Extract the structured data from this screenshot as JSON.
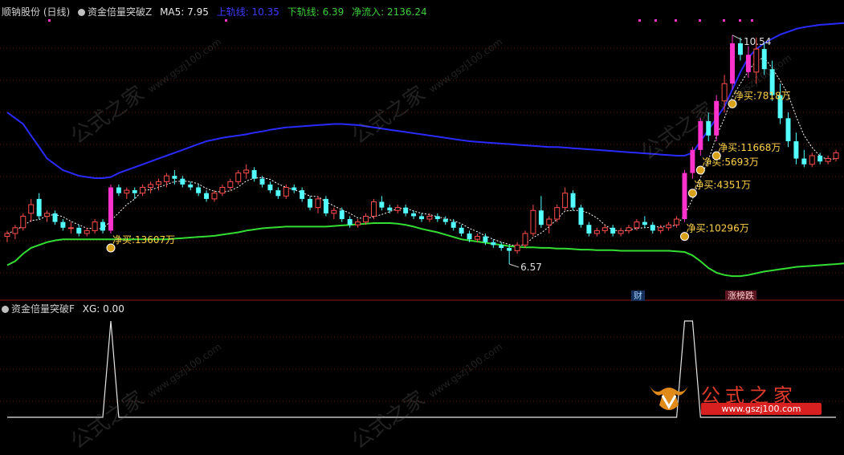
{
  "header": {
    "stock_name": "顺钠股份 (日线)",
    "indicator_name": "资金倍量突破Z",
    "ma5": "MA5: 7.95",
    "upper": "上轨线: 10.35",
    "lower": "下轨线: 6.39",
    "inflow": "净流入: 2136.24"
  },
  "sub_header": {
    "indicator_name": "资金倍量突破F",
    "xg": "XG: 0.00"
  },
  "tags": {
    "finance": "财",
    "limit": "涨榜跌"
  },
  "watermark": {
    "text": "公式之家",
    "url": "www.gszj100.com"
  },
  "logo": {
    "title": "公式之家",
    "url": "www.gszj100.com"
  },
  "colors": {
    "up": "#ff4d4d",
    "down": "#54ffff",
    "signal": "#ff33cc",
    "upper_band": "#2a2aff",
    "lower_band": "#33dd33",
    "ma": "#ffffff",
    "annotation": "#ffd24a"
  },
  "chart_data": {
    "type": "candlestick",
    "price_range": [
      6.0,
      10.9
    ],
    "high_label": "10.54",
    "low_label": "6.57",
    "candles": [
      [
        7.05,
        7.15,
        6.95,
        7.1
      ],
      [
        7.1,
        7.25,
        7.0,
        7.2
      ],
      [
        7.2,
        7.45,
        7.15,
        7.4
      ],
      [
        7.45,
        7.7,
        7.3,
        7.6
      ],
      [
        7.7,
        7.8,
        7.35,
        7.4
      ],
      [
        7.4,
        7.5,
        7.3,
        7.45
      ],
      [
        7.45,
        7.5,
        7.25,
        7.3
      ],
      [
        7.3,
        7.35,
        7.15,
        7.2
      ],
      [
        7.2,
        7.3,
        7.1,
        7.2
      ],
      [
        7.2,
        7.25,
        7.05,
        7.1
      ],
      [
        7.1,
        7.2,
        7.05,
        7.15
      ],
      [
        7.15,
        7.35,
        7.1,
        7.3
      ],
      [
        7.3,
        7.35,
        7.1,
        7.15
      ],
      [
        7.15,
        7.95,
        7.1,
        7.9
      ],
      [
        7.9,
        7.95,
        7.75,
        7.8
      ],
      [
        7.8,
        7.9,
        7.7,
        7.85
      ],
      [
        7.85,
        7.9,
        7.7,
        7.8
      ],
      [
        7.8,
        7.95,
        7.75,
        7.9
      ],
      [
        7.9,
        8.0,
        7.8,
        7.95
      ],
      [
        7.95,
        8.05,
        7.85,
        8.0
      ],
      [
        8.0,
        8.15,
        7.9,
        8.1
      ],
      [
        8.1,
        8.2,
        7.95,
        8.05
      ],
      [
        8.05,
        8.1,
        7.9,
        7.95
      ],
      [
        7.95,
        8.0,
        7.85,
        7.9
      ],
      [
        7.9,
        7.95,
        7.75,
        7.8
      ],
      [
        7.8,
        7.85,
        7.65,
        7.7
      ],
      [
        7.7,
        7.85,
        7.65,
        7.8
      ],
      [
        7.8,
        7.95,
        7.75,
        7.9
      ],
      [
        7.9,
        8.05,
        7.85,
        8.0
      ],
      [
        8.0,
        8.2,
        7.95,
        8.15
      ],
      [
        8.15,
        8.3,
        8.05,
        8.2
      ],
      [
        8.2,
        8.25,
        8.0,
        8.05
      ],
      [
        8.05,
        8.1,
        7.9,
        7.95
      ],
      [
        7.95,
        8.0,
        7.8,
        7.85
      ],
      [
        7.85,
        7.9,
        7.7,
        7.75
      ],
      [
        7.75,
        7.95,
        7.7,
        7.9
      ],
      [
        7.9,
        7.95,
        7.8,
        7.85
      ],
      [
        7.85,
        7.9,
        7.65,
        7.7
      ],
      [
        7.7,
        7.75,
        7.5,
        7.55
      ],
      [
        7.55,
        7.75,
        7.45,
        7.7
      ],
      [
        7.7,
        7.75,
        7.4,
        7.45
      ],
      [
        7.45,
        7.55,
        7.35,
        7.5
      ],
      [
        7.5,
        7.55,
        7.3,
        7.35
      ],
      [
        7.35,
        7.4,
        7.2,
        7.25
      ],
      [
        7.25,
        7.35,
        7.2,
        7.3
      ],
      [
        7.3,
        7.45,
        7.25,
        7.4
      ],
      [
        7.4,
        7.7,
        7.35,
        7.65
      ],
      [
        7.65,
        7.75,
        7.5,
        7.55
      ],
      [
        7.55,
        7.6,
        7.45,
        7.5
      ],
      [
        7.5,
        7.6,
        7.45,
        7.55
      ],
      [
        7.55,
        7.6,
        7.4,
        7.45
      ],
      [
        7.45,
        7.5,
        7.35,
        7.4
      ],
      [
        7.4,
        7.45,
        7.3,
        7.35
      ],
      [
        7.35,
        7.45,
        7.3,
        7.4
      ],
      [
        7.4,
        7.45,
        7.3,
        7.35
      ],
      [
        7.35,
        7.4,
        7.25,
        7.3
      ],
      [
        7.3,
        7.35,
        7.15,
        7.2
      ],
      [
        7.2,
        7.25,
        7.05,
        7.1
      ],
      [
        7.1,
        7.15,
        6.95,
        7.0
      ],
      [
        7.0,
        7.1,
        6.95,
        7.05
      ],
      [
        7.05,
        7.1,
        6.9,
        6.95
      ],
      [
        6.95,
        7.0,
        6.85,
        6.9
      ],
      [
        6.9,
        6.95,
        6.8,
        6.85
      ],
      [
        6.85,
        6.9,
        6.57,
        6.8
      ],
      [
        6.8,
        6.95,
        6.75,
        6.9
      ],
      [
        6.9,
        7.15,
        6.85,
        7.1
      ],
      [
        7.1,
        7.6,
        7.05,
        7.5
      ],
      [
        7.5,
        7.75,
        7.2,
        7.25
      ],
      [
        7.25,
        7.4,
        7.1,
        7.35
      ],
      [
        7.35,
        7.6,
        7.3,
        7.55
      ],
      [
        7.55,
        7.9,
        7.5,
        7.8
      ],
      [
        7.8,
        7.85,
        7.5,
        7.55
      ],
      [
        7.55,
        7.6,
        7.2,
        7.25
      ],
      [
        7.25,
        7.3,
        7.05,
        7.1
      ],
      [
        7.1,
        7.2,
        7.05,
        7.15
      ],
      [
        7.15,
        7.25,
        7.1,
        7.2
      ],
      [
        7.2,
        7.25,
        7.05,
        7.1
      ],
      [
        7.1,
        7.2,
        7.05,
        7.15
      ],
      [
        7.15,
        7.25,
        7.1,
        7.2
      ],
      [
        7.2,
        7.35,
        7.15,
        7.3
      ],
      [
        7.3,
        7.4,
        7.2,
        7.25
      ],
      [
        7.25,
        7.3,
        7.1,
        7.15
      ],
      [
        7.15,
        7.25,
        7.1,
        7.2
      ],
      [
        7.2,
        7.3,
        7.15,
        7.25
      ],
      [
        7.25,
        7.4,
        7.2,
        7.35
      ],
      [
        7.35,
        8.2,
        7.3,
        8.15
      ],
      [
        8.15,
        8.6,
        8.05,
        8.55
      ],
      [
        8.55,
        9.1,
        8.45,
        9.05
      ],
      [
        9.05,
        9.2,
        8.7,
        8.8
      ],
      [
        8.8,
        9.5,
        8.7,
        9.4
      ],
      [
        9.4,
        9.85,
        9.2,
        9.7
      ],
      [
        9.7,
        10.54,
        9.6,
        10.4
      ],
      [
        10.4,
        10.5,
        10.1,
        10.2
      ],
      [
        10.2,
        10.35,
        9.8,
        9.9
      ],
      [
        9.9,
        10.5,
        9.7,
        10.3
      ],
      [
        10.3,
        10.4,
        9.85,
        9.95
      ],
      [
        9.95,
        10.1,
        9.4,
        9.5
      ],
      [
        9.5,
        9.7,
        9.0,
        9.1
      ],
      [
        9.1,
        9.2,
        8.6,
        8.7
      ],
      [
        8.7,
        8.85,
        8.3,
        8.4
      ],
      [
        8.4,
        8.55,
        8.25,
        8.3
      ],
      [
        8.3,
        8.5,
        8.25,
        8.45
      ],
      [
        8.45,
        8.5,
        8.3,
        8.35
      ],
      [
        8.35,
        8.45,
        8.3,
        8.4
      ],
      [
        8.4,
        8.55,
        8.35,
        8.5
      ]
    ],
    "signal_indices": [
      13,
      85,
      86,
      87,
      89,
      91,
      93
    ],
    "upper_band": [
      9.2,
      9.1,
      9.0,
      8.8,
      8.6,
      8.4,
      8.3,
      8.2,
      8.15,
      8.1,
      8.08,
      8.06,
      8.06,
      8.08,
      8.15,
      8.2,
      8.25,
      8.3,
      8.35,
      8.4,
      8.45,
      8.5,
      8.55,
      8.6,
      8.65,
      8.7,
      8.73,
      8.76,
      8.78,
      8.8,
      8.82,
      8.85,
      8.87,
      8.9,
      8.92,
      8.94,
      8.95,
      8.96,
      8.97,
      8.98,
      8.99,
      9.0,
      9.0,
      8.99,
      8.98,
      8.96,
      8.94,
      8.92,
      8.9,
      8.88,
      8.86,
      8.84,
      8.82,
      8.8,
      8.78,
      8.76,
      8.74,
      8.72,
      8.7,
      8.69,
      8.68,
      8.67,
      8.66,
      8.65,
      8.64,
      8.63,
      8.62,
      8.61,
      8.6,
      8.6,
      8.59,
      8.58,
      8.57,
      8.56,
      8.55,
      8.54,
      8.53,
      8.52,
      8.51,
      8.5,
      8.49,
      8.48,
      8.47,
      8.46,
      8.45,
      8.45,
      8.5,
      8.7,
      8.9,
      9.1,
      9.3,
      9.6,
      9.9,
      10.15,
      10.3,
      10.4,
      10.48,
      10.55,
      10.6,
      10.65,
      10.68,
      10.7,
      10.72,
      10.73,
      10.74,
      10.75
    ],
    "lower_band": [
      6.55,
      6.62,
      6.75,
      6.85,
      6.9,
      6.95,
      6.98,
      7.0,
      7.0,
      7.0,
      7.0,
      7.0,
      7.0,
      7.0,
      7.0,
      7.0,
      7.0,
      7.0,
      7.0,
      7.0,
      7.0,
      7.01,
      7.02,
      7.03,
      7.04,
      7.05,
      7.06,
      7.08,
      7.1,
      7.12,
      7.15,
      7.17,
      7.19,
      7.2,
      7.21,
      7.22,
      7.22,
      7.22,
      7.22,
      7.22,
      7.22,
      7.23,
      7.24,
      7.25,
      7.26,
      7.27,
      7.28,
      7.28,
      7.28,
      7.27,
      7.25,
      7.22,
      7.18,
      7.15,
      7.12,
      7.08,
      7.04,
      7.0,
      6.98,
      6.96,
      6.94,
      6.92,
      6.9,
      6.88,
      6.87,
      6.86,
      6.86,
      6.85,
      6.85,
      6.84,
      6.84,
      6.83,
      6.82,
      6.82,
      6.81,
      6.81,
      6.81,
      6.8,
      6.8,
      6.8,
      6.8,
      6.8,
      6.8,
      6.8,
      6.79,
      6.78,
      6.72,
      6.62,
      6.5,
      6.42,
      6.38,
      6.36,
      6.36,
      6.38,
      6.41,
      6.44,
      6.46,
      6.48,
      6.5,
      6.52,
      6.53,
      6.54,
      6.55,
      6.56,
      6.57,
      6.58
    ],
    "annotations": [
      {
        "index": 13,
        "text": "净买:13607万"
      },
      {
        "index": 85,
        "text": "净买:10296万"
      },
      {
        "index": 86,
        "text": "净买:4351万"
      },
      {
        "index": 87,
        "text": "净买:5693万"
      },
      {
        "index": 89,
        "text": "净买:11668万"
      },
      {
        "index": 91,
        "text": "净买:7818万"
      }
    ],
    "indicator_spikes": [
      13,
      85,
      86
    ]
  }
}
